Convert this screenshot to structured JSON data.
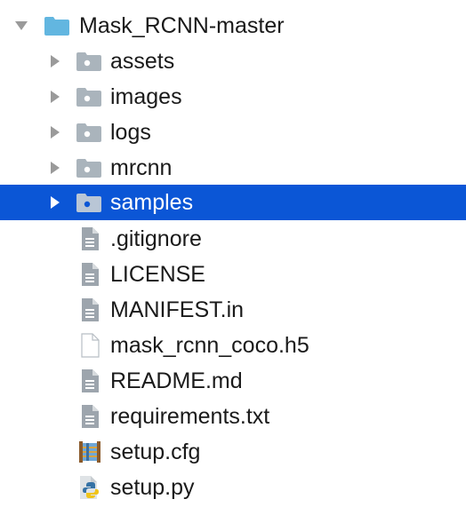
{
  "project_tree": {
    "root": {
      "label": "Mask_RCNN-master",
      "icon": "folder-icon",
      "expanded": true
    },
    "folders": [
      {
        "label": "assets",
        "icon": "folder-icon",
        "selected": false
      },
      {
        "label": "images",
        "icon": "folder-icon",
        "selected": false
      },
      {
        "label": "logs",
        "icon": "folder-icon",
        "selected": false
      },
      {
        "label": "mrcnn",
        "icon": "folder-icon",
        "selected": false
      },
      {
        "label": "samples",
        "icon": "folder-icon",
        "selected": true
      }
    ],
    "files": [
      {
        "label": ".gitignore",
        "icon": "text-file-icon"
      },
      {
        "label": "LICENSE",
        "icon": "text-file-icon"
      },
      {
        "label": "MANIFEST.in",
        "icon": "text-file-icon"
      },
      {
        "label": "mask_rcnn_coco.h5",
        "icon": "blank-file-icon"
      },
      {
        "label": "README.md",
        "icon": "text-file-icon"
      },
      {
        "label": "requirements.txt",
        "icon": "text-file-icon"
      },
      {
        "label": "setup.cfg",
        "icon": "config-file-icon"
      },
      {
        "label": "setup.py",
        "icon": "python-file-icon"
      }
    ]
  },
  "colors": {
    "selection": "#0b56d6",
    "root_folder": "#62b6e0",
    "folder": "#aab4bc",
    "arrow": "#9a9a9a",
    "text": "#1a1a1a"
  }
}
